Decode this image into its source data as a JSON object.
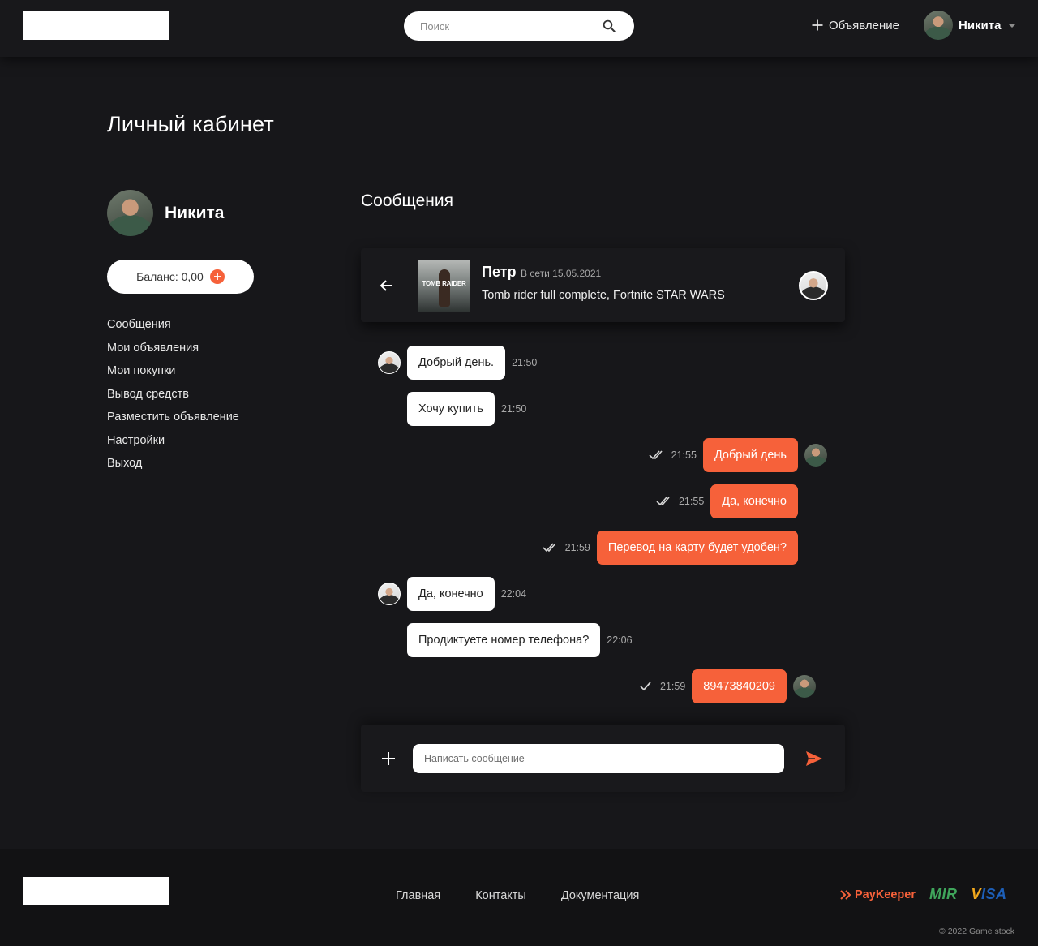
{
  "header": {
    "search_placeholder": "Поиск",
    "new_ad_label": "Объявление",
    "user_name": "Никита"
  },
  "page": {
    "title": "Личный кабинет"
  },
  "profile": {
    "name": "Никита",
    "balance_label": "Баланс: 0,00"
  },
  "sidebar": {
    "items": [
      {
        "label": "Сообщения"
      },
      {
        "label": "Мои объявления"
      },
      {
        "label": "Мои покупки"
      },
      {
        "label": "Вывод средств"
      },
      {
        "label": "Разместить объявление"
      },
      {
        "label": "Настройки"
      },
      {
        "label": "Выход"
      }
    ]
  },
  "messages_section": {
    "title": "Сообщения"
  },
  "chat": {
    "peer_name": "Петр",
    "peer_status": "В сети 15.05.2021",
    "subject": "Tomb rider full complete, Fortnite STAR WARS",
    "thumb_text": "TOMB RAIDER",
    "messages": [
      {
        "text": "Добрый день.",
        "time": "21:50"
      },
      {
        "text": "Хочу купить",
        "time": "21:50"
      },
      {
        "text": "Добрый день",
        "time": "21:55"
      },
      {
        "text": "Да, конечно",
        "time": "21:55"
      },
      {
        "text": "Перевод на карту будет удобен?",
        "time": "21:59"
      },
      {
        "text": "Да, конечно",
        "time": "22:04"
      },
      {
        "text": "Продиктуете номер телефона?",
        "time": "22:06"
      },
      {
        "text": "89473840209",
        "time": "21:59"
      }
    ],
    "composer_placeholder": "Написать сообщение"
  },
  "footer": {
    "links": [
      {
        "label": "Главная"
      },
      {
        "label": "Контакты"
      },
      {
        "label": "Документация"
      }
    ],
    "payment_paykeeper_a": "Pay",
    "payment_paykeeper_b": "Keeper",
    "payment_mir": "MIR",
    "payment_visa_a": "V",
    "payment_visa_b": "ISA",
    "copyright": "© 2022 Game stock"
  },
  "colors": {
    "accent": "#f6613a",
    "background": "#17171a",
    "footer_bg": "#121214"
  }
}
